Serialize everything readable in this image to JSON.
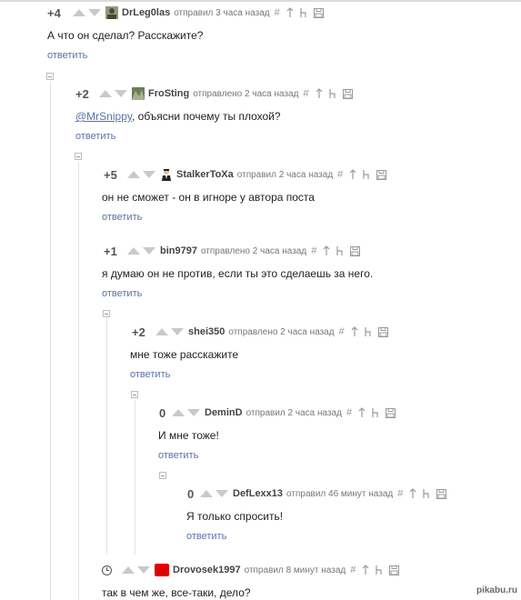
{
  "comments": [
    {
      "rating": "+4",
      "username": "DrLeg0las",
      "meta": "отправил 3 часа назад",
      "avatar": "photo-avatar",
      "text": "А что он сделал? Расскажите?",
      "reply": "ответить"
    },
    {
      "rating": "+2",
      "username": "FroSting",
      "meta": "отправлено 2 часа назад",
      "avatar": "photo-avatar",
      "mention": "@MrSnippy",
      "text": ",  объясни почему ты плохой?",
      "reply": "ответить"
    },
    {
      "rating": "+5",
      "username": "StalkerToXa",
      "meta": "отправил 2 часа назад",
      "avatar": "suit-avatar",
      "text": "он не сможет - он в игноре у автора поста",
      "reply": "ответить"
    },
    {
      "rating": "+1",
      "username": "bin9797",
      "meta": "отправлено 2 часа назад",
      "text": "я думаю он не против, если ты это сделаешь за него.",
      "reply": "ответить"
    },
    {
      "rating": "+2",
      "username": "shei350",
      "meta": "отправлено 2 часа назад",
      "text": "мне тоже расскажите",
      "reply": "ответить"
    },
    {
      "rating": "0",
      "username": "DeminD",
      "meta": "отправил 2 часа назад",
      "text": "И мне тоже!",
      "reply": "ответить"
    },
    {
      "rating": "0",
      "username": "DefLexx13",
      "meta": "отправил 46 минут назад",
      "text": "Я только спросить!",
      "reply": "ответить"
    },
    {
      "rating": "",
      "username": "Drovosek1997",
      "meta": "отправил 8 минут назад",
      "avatar": "red-avatar",
      "text": "так в чем же, все-таки, дело?",
      "reply": ""
    }
  ],
  "icons": [
    "hash-icon",
    "parent-arrow-icon",
    "branch-icon",
    "save-icon",
    "clock-icon",
    "upvote-icon",
    "downvote-icon",
    "collapse-toggle-icon"
  ],
  "colors": {
    "link": "#5873a8",
    "arrow": "#c9c9c9",
    "avatar_red": "#e00000"
  },
  "watermark": "pikabu.ru"
}
